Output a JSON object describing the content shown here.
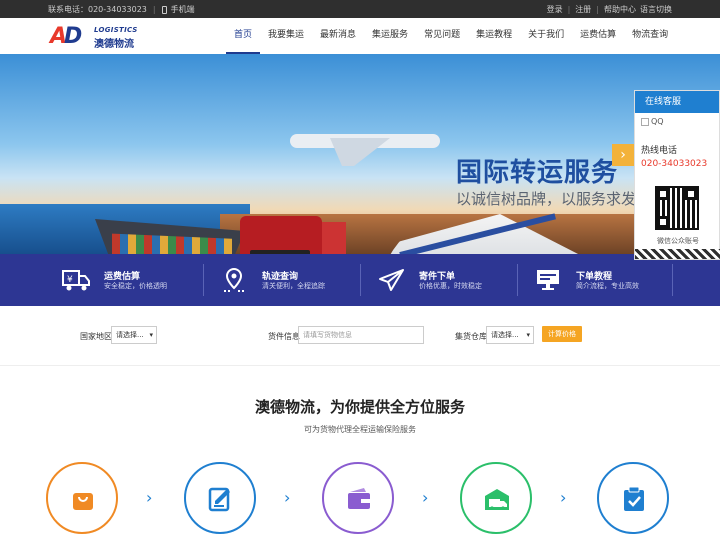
{
  "topbar": {
    "phone_label": "联系电话：020-34033023",
    "mobile_label": "手机端",
    "login": "登录",
    "register": "注册",
    "help": "帮助中心",
    "language": "语言切换"
  },
  "logo": {
    "mark_a": "A",
    "mark_d": "D",
    "en": "LOGISTICS",
    "cn": "澳德物流"
  },
  "nav": {
    "items": [
      "首页",
      "我要集运",
      "最新消息",
      "集运服务",
      "常见问题",
      "集运教程",
      "关于我们",
      "运费估算",
      "物流查询"
    ]
  },
  "banner": {
    "title": "国际转运服务",
    "subtitle": "以诚信树品牌，以服务求发展",
    "next_icon": "chevron-right-icon",
    "next_glyph": "›"
  },
  "services": [
    {
      "title": "运费估算",
      "desc": "安全稳定，价格透明",
      "icon": "truck-yen-icon"
    },
    {
      "title": "轨迹查询",
      "desc": "清关便利，全程追踪",
      "icon": "location-pin-icon"
    },
    {
      "title": "寄件下单",
      "desc": "价格优惠，时效稳定",
      "icon": "paper-plane-icon"
    },
    {
      "title": "下单教程",
      "desc": "简介流程，专业高效",
      "icon": "monitor-icon"
    }
  ],
  "filter": {
    "country_label": "国家地区",
    "country_value": "请选择...",
    "goods_label": "货件信息",
    "goods_placeholder": "请填写货物信息",
    "warehouse_label": "集货仓库",
    "warehouse_value": "请选择...",
    "calc_button": "计算价格"
  },
  "section": {
    "title": "澳德物流，为你提供全方位服务",
    "subtitle": "可为货物代理全程运输保险服务"
  },
  "steps": [
    {
      "icon": "shopping-bag-icon",
      "color": "#f08a24"
    },
    {
      "icon": "edit-form-icon",
      "color": "#1f7fd0"
    },
    {
      "icon": "wallet-icon",
      "color": "#8a5cd0"
    },
    {
      "icon": "warehouse-truck-icon",
      "color": "#2bbf6a"
    },
    {
      "icon": "clipboard-check-icon",
      "color": "#1f7fd0"
    }
  ],
  "float_panel": {
    "header": "在线客服",
    "qq": "QQ",
    "hotline_label": "热线电话",
    "hotline_number": "020-34033023",
    "wechat_label": "微信公众账号"
  },
  "colors": {
    "brand_blue": "#2d3693",
    "accent_orange": "#f5a523",
    "nav_active": "#1f3b8f",
    "logo_red": "#e8392b"
  }
}
